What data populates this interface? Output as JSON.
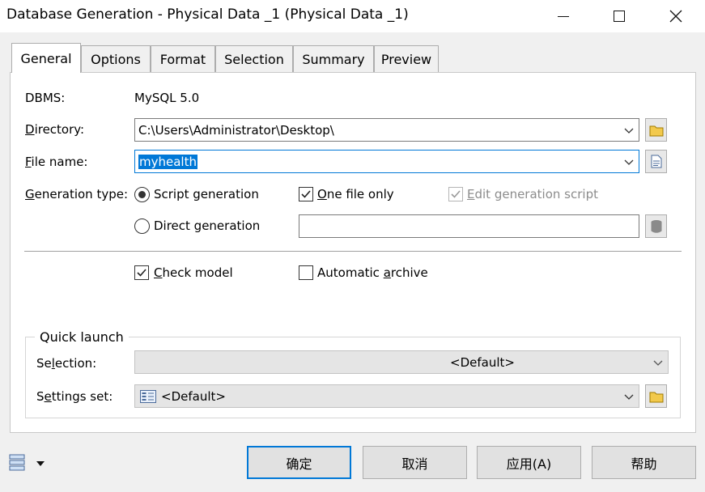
{
  "window": {
    "title": "Database Generation - Physical Data _1 (Physical Data _1)"
  },
  "tabs": [
    {
      "label": "General",
      "active": true
    },
    {
      "label": "Options"
    },
    {
      "label": "Format"
    },
    {
      "label": "Selection"
    },
    {
      "label": "Summary"
    },
    {
      "label": "Preview"
    }
  ],
  "general": {
    "dbms_label": "DBMS:",
    "dbms_value": "MySQL 5.0",
    "directory_label_u": "D",
    "directory_label_rest": "irectory:",
    "directory_value": "C:\\Users\\Administrator\\Desktop\\",
    "filename_label_u": "F",
    "filename_label_rest": "ile name:",
    "filename_value": "myhealth",
    "gentype_label_u": "G",
    "gentype_label_rest": "eneration type:",
    "script_generation": "Script generation",
    "direct_generation": "Direct generation",
    "one_file_only_u": "O",
    "one_file_only_rest": "ne file only",
    "edit_script_u": "E",
    "edit_script_rest": "dit generation script",
    "check_model_u": "C",
    "check_model_rest": "heck model",
    "auto_archive_pre": "Automatic ",
    "auto_archive_u": "a",
    "auto_archive_rest": "rchive"
  },
  "quick_launch": {
    "title": "Quick launch",
    "selection_label_pre": "Se",
    "selection_label_u": "l",
    "selection_label_rest": "ection:",
    "selection_value": "<Default>",
    "settings_label_pre": "S",
    "settings_label_u": "e",
    "settings_label_rest": "ttings set:",
    "settings_value": "<Default>"
  },
  "buttons": {
    "ok": "确定",
    "cancel": "取消",
    "apply": "应用(A)",
    "help": "帮助"
  },
  "colors": {
    "accent": "#0078d7",
    "folder": "#e8b400"
  }
}
